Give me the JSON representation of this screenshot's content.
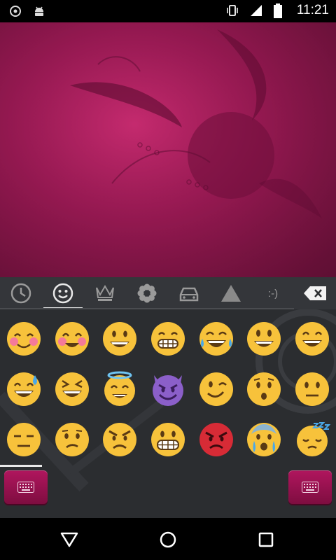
{
  "status_bar": {
    "time": "11:21",
    "left_icons": [
      "sync-icon",
      "android-debug-icon"
    ],
    "right_icons": [
      "vibrate-icon",
      "signal-icon",
      "battery-icon"
    ]
  },
  "colors": {
    "accent": "#b0165e",
    "keyboard_bg": "#2b2d30",
    "emoji_yellow": "#f7c23b",
    "emoji_purple": "#8b5fc9",
    "emoji_red": "#d72b36"
  },
  "emoji_tabs": [
    {
      "icon": "recent-clock-icon",
      "active": false
    },
    {
      "icon": "smiley-icon",
      "active": true
    },
    {
      "icon": "crown-icon",
      "active": false
    },
    {
      "icon": "flower-icon",
      "active": false
    },
    {
      "icon": "car-icon",
      "active": false
    },
    {
      "icon": "triangle-icon",
      "active": false
    },
    {
      "icon": "emoticon-text-icon",
      "label": ":-)",
      "active": false
    },
    {
      "icon": "backspace-icon",
      "active": false
    }
  ],
  "emoji_grid": [
    [
      "blush",
      "smiling-eyes-blush",
      "grinning",
      "grimace-grin",
      "tears-of-joy",
      "smiley",
      "grin"
    ],
    [
      "sweat-smile",
      "laughing",
      "innocent",
      "smiling-imp",
      "wink",
      "hushed",
      "neutral"
    ],
    [
      "expressionless",
      "confused",
      "angry",
      "grimacing",
      "pouting",
      "cold-sweat-crying",
      "sleepy"
    ]
  ],
  "bottom_buttons": [
    "keyboard-switch-icon",
    "keyboard-switch-icon"
  ],
  "nav_bar": [
    "back-icon",
    "home-icon",
    "recents-icon"
  ]
}
